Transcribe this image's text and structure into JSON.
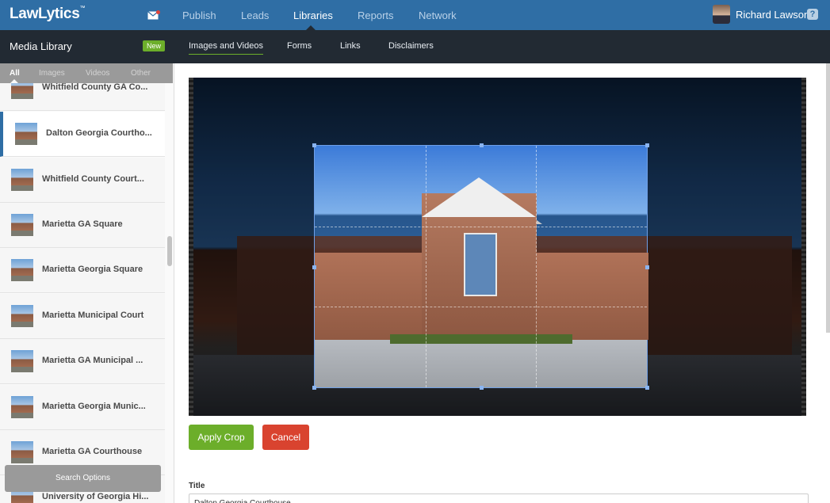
{
  "app": {
    "logo": "LawLytics",
    "logo_mark": "™"
  },
  "topnav": {
    "items": [
      {
        "label": "Publish"
      },
      {
        "label": "Leads"
      },
      {
        "label": "Libraries"
      },
      {
        "label": "Reports"
      },
      {
        "label": "Network"
      }
    ],
    "active": "Libraries"
  },
  "user": {
    "name": "Richard Lawson",
    "help": "?"
  },
  "subnav": {
    "title": "Media Library",
    "badge": "New",
    "tabs": [
      {
        "label": "Images and Videos"
      },
      {
        "label": "Forms"
      },
      {
        "label": "Links"
      },
      {
        "label": "Disclaimers"
      }
    ],
    "active": "Images and Videos"
  },
  "sidebar": {
    "filters": [
      {
        "label": "All"
      },
      {
        "label": "Images"
      },
      {
        "label": "Videos"
      },
      {
        "label": "Other"
      }
    ],
    "active_filter": "All",
    "items": [
      {
        "title": "Whitfield County GA Co..."
      },
      {
        "title": "Dalton Georgia Courtho...",
        "selected": true
      },
      {
        "title": "Whitfield County Court..."
      },
      {
        "title": "Marietta GA Square"
      },
      {
        "title": "Marietta Georgia Square"
      },
      {
        "title": "Marietta Municipal Court"
      },
      {
        "title": "Marietta GA Municipal ..."
      },
      {
        "title": "Marietta Georgia Munic..."
      },
      {
        "title": "Marietta GA Courthouse"
      },
      {
        "title": "University of Georgia Hi..."
      }
    ],
    "search_options": "Search Options"
  },
  "editor": {
    "apply_label": "Apply Crop",
    "cancel_label": "Cancel",
    "title_label": "Title",
    "title_value": "Dalton Georgia Courthouse"
  },
  "colors": {
    "topbar": "#2f6ea5",
    "subbar": "#222a33",
    "accent_green": "#6cae2a",
    "cancel_red": "#d9432f"
  }
}
